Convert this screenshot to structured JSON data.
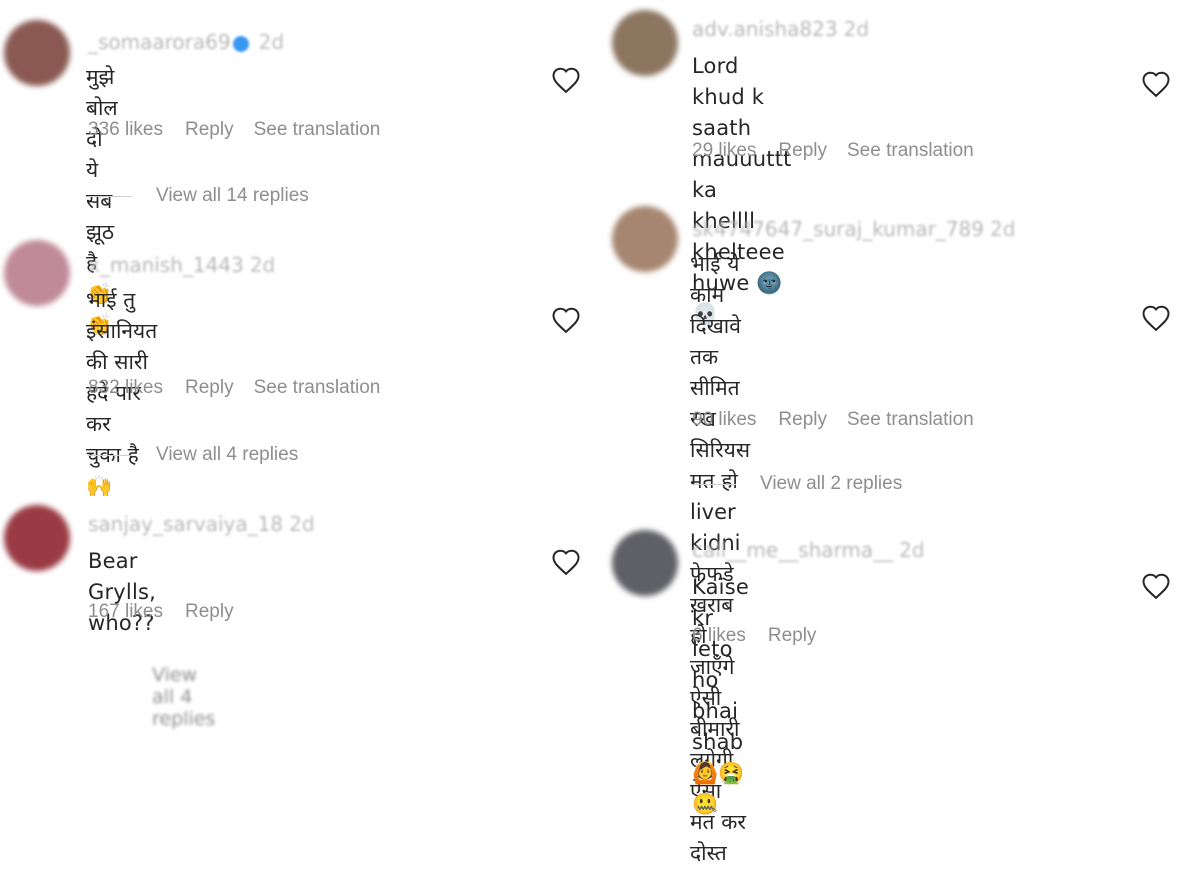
{
  "left_comments": [
    {
      "username": "_somaarora69",
      "verified": true,
      "time": "2d",
      "text": "मुझे बोल दो ये सब झूठ है 👏👏",
      "likes": "336 likes",
      "reply": "Reply",
      "translation": "See translation",
      "view_replies": "View all 14 replies",
      "avatar_color": "#8a5a52"
    },
    {
      "username": "x_manish_1443",
      "verified": false,
      "time": "2d",
      "text": "भाई तु इंसानियत की सारी हदें पार कर\nचुका है 🙌",
      "likes": "832 likes",
      "reply": "Reply",
      "translation": "See translation",
      "view_replies": "View all 4 replies",
      "avatar_color": "#c08a9a"
    },
    {
      "username": "sanjay_sarvaiya_18",
      "verified": false,
      "time": "2d",
      "text": "Bear Grylls, who??",
      "likes": "167 likes",
      "reply": "Reply",
      "translation": "",
      "view_replies": "View all 4 replies",
      "avatar_color": "#9a3a44"
    }
  ],
  "right_comments": [
    {
      "username": "adv.anisha823",
      "verified": false,
      "time": "2d",
      "text": "Lord khud k saath mauuuttt ka\nkhellll khelteee huwe 🌚💀",
      "likes": "29 likes",
      "reply": "Reply",
      "translation": "See translation",
      "view_replies": "",
      "avatar_color": "#8c7660"
    },
    {
      "username": "sk4747647_suraj_kumar_789",
      "verified": false,
      "time": "2d",
      "text": "भाई ये काम दिखावे तक सीमित रख\nसिरियस मत हो liver kidni फेफड़े ख़राब\nहो जाएँगे ऐसी बीमारी लगेगी ऐसा मत कर\nदोस्त",
      "likes": "90 likes",
      "reply": "Reply",
      "translation": "See translation",
      "view_replies": "View all 2 replies",
      "avatar_color": "#a68670"
    },
    {
      "username": "call__me__sharma__",
      "verified": false,
      "time": "2d",
      "text": "Kaise kr leto ho bhai shab 🙆🤮🤐",
      "likes": "6 likes",
      "reply": "Reply",
      "translation": "",
      "view_replies": "",
      "avatar_color": "#5f5f66"
    }
  ],
  "icons": {
    "like": "heart-outline-icon"
  },
  "colors": {
    "text": "#262626",
    "muted": "#8e8e8e",
    "verified": "#3897f0"
  }
}
